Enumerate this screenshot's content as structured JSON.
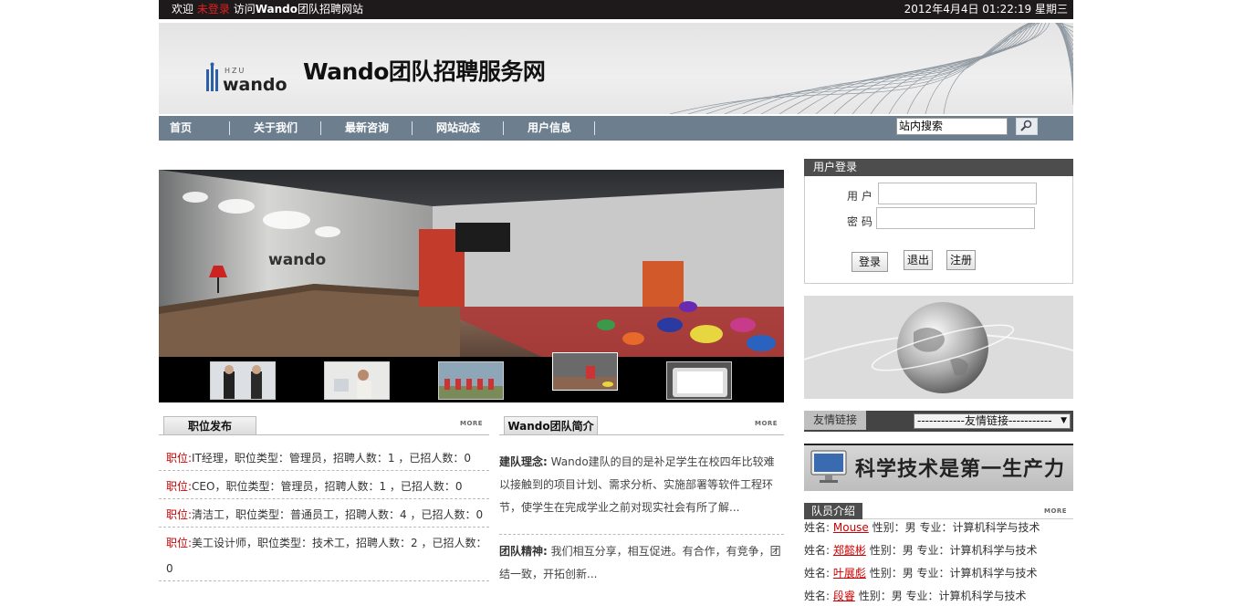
{
  "topbar": {
    "welcome": "欢迎",
    "not_logged_in": "未登录",
    "visit_prefix": "访问",
    "visit_brand": "Wando",
    "visit_suffix": "团队招聘网站",
    "datetime": "2012年4月4日 01:22:19 星期三"
  },
  "banner": {
    "logo_small": "HZU",
    "logo_text": "wando",
    "title": "Wando团队招聘服务网"
  },
  "nav": {
    "items": [
      {
        "label": "首页"
      },
      {
        "label": "关于我们"
      },
      {
        "label": "最新咨询"
      },
      {
        "label": "网站动态"
      },
      {
        "label": "用户信息"
      }
    ],
    "search_value": "站内搜索"
  },
  "jobs": {
    "title": "职位发布",
    "more": "MORE",
    "items": [
      {
        "label": "职位:",
        "text": "IT经理，职位类型：管理员，招聘人数：1 ，已招人数：0"
      },
      {
        "label": "职位:",
        "text": "CEO，职位类型：管理员，招聘人数：1 ，已招人数：0"
      },
      {
        "label": "职位:",
        "text": "清洁工，职位类型：普通员工，招聘人数：4 ，已招人数：0"
      },
      {
        "label": "职位:",
        "text": "美工设计师，职位类型：技术工，招聘人数：2 ，已招人数："
      }
    ],
    "overflow": "0"
  },
  "intro": {
    "title": "Wando团队简介",
    "more": "MORE",
    "idea_label": "建队理念:",
    "idea_text": "Wando建队的目的是补足学生在校四年比较难以接触到的项目计划、需求分析、实施部署等软件工程环节，使学生在完成学业之前对现实社会有所了解...",
    "spirit_label": "团队精神:",
    "spirit_text": "我们相互分享，相互促进。有合作，有竞争，团结一致，开拓创新..."
  },
  "login": {
    "title": "用户登录",
    "user_label": "用 户",
    "pass_label": "密 码",
    "login_btn": "登录",
    "logout_btn": "退出",
    "register_btn": "注册"
  },
  "friends": {
    "label": "友情链接",
    "select_value": "------------友情链接-----------",
    "arrow": "▼"
  },
  "ad": {
    "text": "科学技术是第一生产力"
  },
  "members": {
    "title": "队员介绍",
    "more": "MORE",
    "items": [
      {
        "prefix": "姓名:",
        "name": "Mouse",
        "info": "性别：男 专业：计算机科学与技术"
      },
      {
        "prefix": "姓名:",
        "name": "郑懿彬",
        "info": "性别：男 专业：计算机科学与技术"
      },
      {
        "prefix": "姓名:",
        "name": "叶展彪",
        "info": "性别：男 专业：计算机科学与技术"
      },
      {
        "prefix": "姓名:",
        "name": "段睿",
        "info": "性别：男 专业：计算机科学与技术"
      }
    ]
  }
}
